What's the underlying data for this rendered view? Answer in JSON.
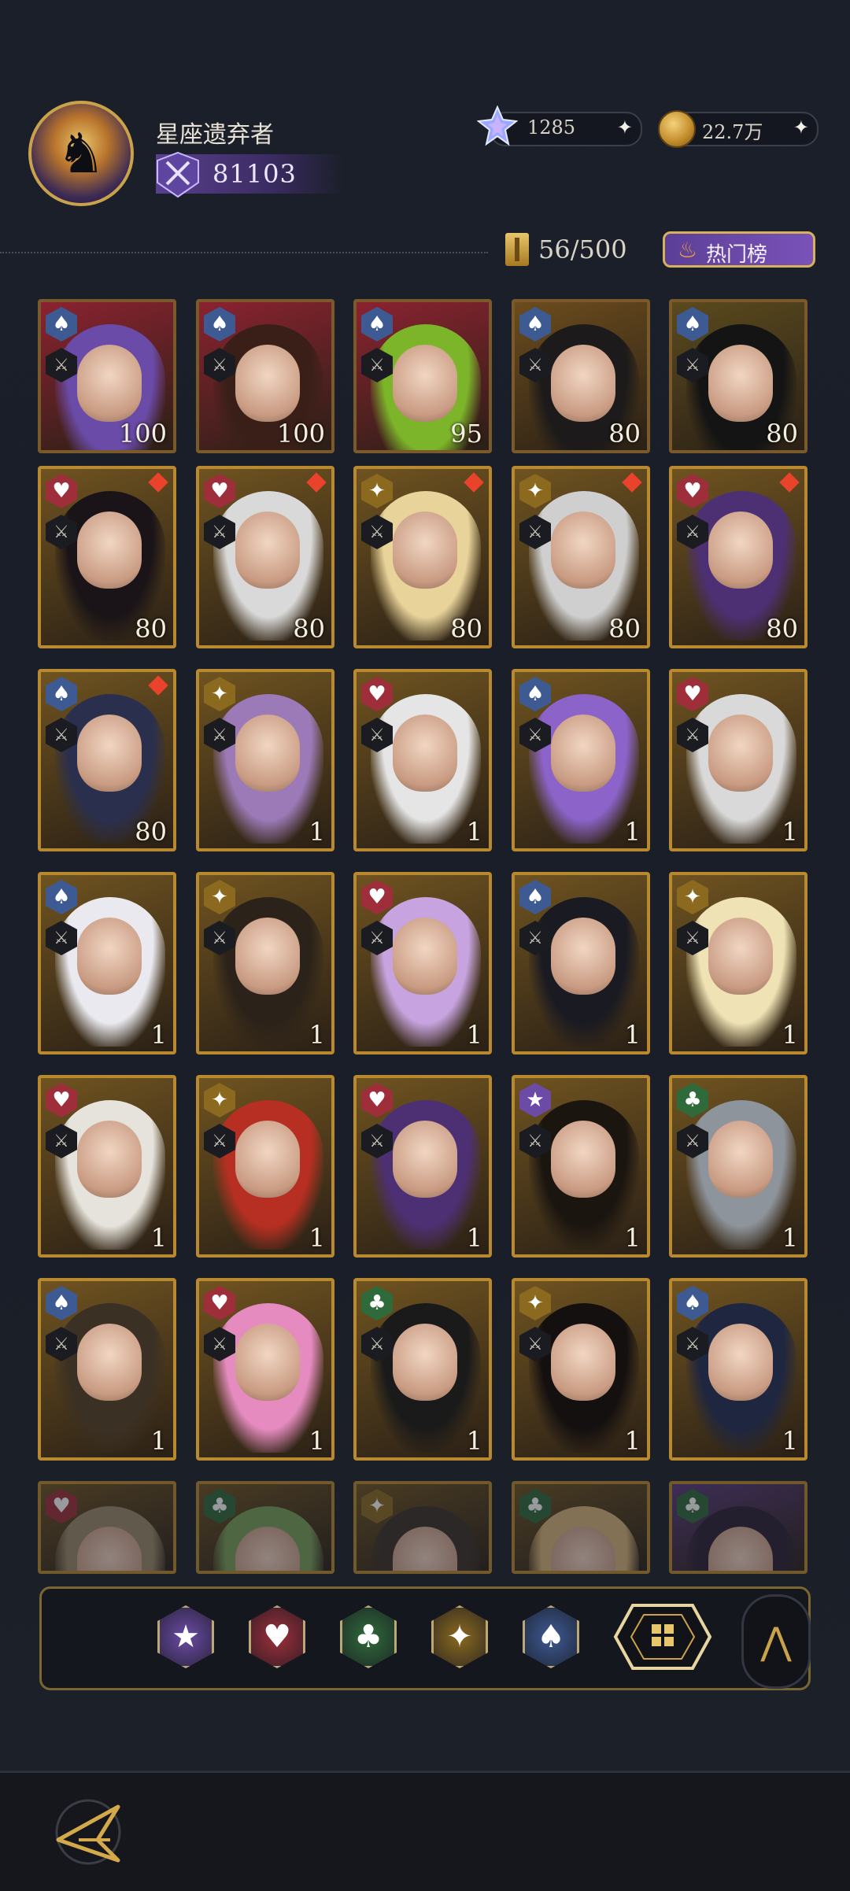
{
  "player": {
    "name": "星座遗弃者",
    "rank_value": "81103"
  },
  "currencies": {
    "gems": "1285",
    "gold": "22.7万"
  },
  "capacity": "56/500",
  "hot_button_label": "热门榜",
  "cards": [
    {
      "suit": "spade",
      "level": "100",
      "star": false,
      "bg": "#8b2230",
      "tone": "#6a4ba8"
    },
    {
      "suit": "spade",
      "level": "100",
      "star": false,
      "bg": "#8b2230",
      "tone": "#3a1f18"
    },
    {
      "suit": "spade",
      "level": "95",
      "star": false,
      "bg": "#8b2230",
      "tone": "#7cb52a"
    },
    {
      "suit": "spade",
      "level": "80",
      "star": false,
      "bg": "#6b4c1d",
      "tone": "#1c1a1a"
    },
    {
      "suit": "spade",
      "level": "80",
      "star": false,
      "bg": "#5b4a1e",
      "tone": "#141414"
    },
    {
      "suit": "heart",
      "level": "80",
      "star": true,
      "bg": "#6f5320",
      "tone": "#1a1418"
    },
    {
      "suit": "heart",
      "level": "80",
      "star": true,
      "bg": "#6f5320",
      "tone": "#d9d9d9"
    },
    {
      "suit": "diamond",
      "level": "80",
      "star": true,
      "bg": "#6f5320",
      "tone": "#e8d39a"
    },
    {
      "suit": "diamond",
      "level": "80",
      "star": true,
      "bg": "#6f5320",
      "tone": "#cfcfcf"
    },
    {
      "suit": "heart",
      "level": "80",
      "star": true,
      "bg": "#6f5320",
      "tone": "#4d2f73"
    },
    {
      "suit": "spade",
      "level": "80",
      "star": true,
      "bg": "#6f5320",
      "tone": "#2a2f4e"
    },
    {
      "suit": "diamond",
      "level": "1",
      "star": false,
      "bg": "#6f5320",
      "tone": "#9c7ab8"
    },
    {
      "suit": "heart",
      "level": "1",
      "star": false,
      "bg": "#6f5320",
      "tone": "#e5e5e5"
    },
    {
      "suit": "spade",
      "level": "1",
      "star": false,
      "bg": "#6f5320",
      "tone": "#8b63c9"
    },
    {
      "suit": "heart",
      "level": "1",
      "star": false,
      "bg": "#6f5320",
      "tone": "#d9d9d9"
    },
    {
      "suit": "spade",
      "level": "1",
      "star": false,
      "bg": "#6f5320",
      "tone": "#e9e9ef"
    },
    {
      "suit": "diamond",
      "level": "1",
      "star": false,
      "bg": "#6f5320",
      "tone": "#2b2219"
    },
    {
      "suit": "heart",
      "level": "1",
      "star": false,
      "bg": "#6f5320",
      "tone": "#c7a4e0"
    },
    {
      "suit": "spade",
      "level": "1",
      "star": false,
      "bg": "#6f5320",
      "tone": "#1a1a22"
    },
    {
      "suit": "diamond",
      "level": "1",
      "star": false,
      "bg": "#6f5320",
      "tone": "#efe3b5"
    },
    {
      "suit": "heart",
      "level": "1",
      "star": false,
      "bg": "#6f5320",
      "tone": "#e6e3dc"
    },
    {
      "suit": "diamond",
      "level": "1",
      "star": false,
      "bg": "#6f5320",
      "tone": "#b72f22"
    },
    {
      "suit": "heart",
      "level": "1",
      "star": false,
      "bg": "#6f5320",
      "tone": "#4d2f73"
    },
    {
      "suit": "star",
      "level": "1",
      "star": false,
      "bg": "#6f5320",
      "tone": "#1b1510"
    },
    {
      "suit": "club",
      "level": "1",
      "star": false,
      "bg": "#6f5320",
      "tone": "#8e949c"
    },
    {
      "suit": "spade",
      "level": "1",
      "star": false,
      "bg": "#6f5320",
      "tone": "#3b3024"
    },
    {
      "suit": "heart",
      "level": "1",
      "star": false,
      "bg": "#6f5320",
      "tone": "#e58bc0"
    },
    {
      "suit": "club",
      "level": "1",
      "star": false,
      "bg": "#6f5320",
      "tone": "#1a1a1a"
    },
    {
      "suit": "diamond",
      "level": "1",
      "star": false,
      "bg": "#6f5320",
      "tone": "#141010"
    },
    {
      "suit": "spade",
      "level": "1",
      "star": false,
      "bg": "#6f5320",
      "tone": "#1e2640"
    },
    {
      "suit": "heart",
      "level": "",
      "star": false,
      "bg": "#6f5320",
      "tone": "#9a8a6a",
      "partial": true
    },
    {
      "suit": "club",
      "level": "",
      "star": false,
      "bg": "#6f5320",
      "tone": "#7aa05a",
      "partial": true
    },
    {
      "suit": "diamond",
      "level": "",
      "star": false,
      "bg": "#6f5320",
      "tone": "#3a3028",
      "partial": true
    },
    {
      "suit": "club",
      "level": "",
      "star": false,
      "bg": "#6f5320",
      "tone": "#d8b47a",
      "partial": true
    },
    {
      "suit": "club",
      "level": "",
      "star": false,
      "bg": "#5a3a7a",
      "tone": "#2a1f35",
      "partial": true
    }
  ],
  "suit_colors": {
    "spade": "#3d5a93",
    "heart": "#9e2f3a",
    "diamond": "#8b6a1f",
    "club": "#2f6b3a",
    "star": "#6b4ba6"
  },
  "suit_glyphs": {
    "spade": "♠",
    "heart": "♥",
    "diamond": "✦",
    "club": "♣",
    "star": "★"
  },
  "filters": [
    {
      "name": "star-filter",
      "glyph": "★",
      "color": "#6b4ba6"
    },
    {
      "name": "heart-filter",
      "glyph": "♥",
      "color": "#9e2f3a"
    },
    {
      "name": "club-filter",
      "glyph": "♣",
      "color": "#2f6b3a"
    },
    {
      "name": "diamond-filter",
      "glyph": "✦",
      "color": "#8b6a1f"
    },
    {
      "name": "spade-filter",
      "glyph": "♠",
      "color": "#3d5a93"
    }
  ],
  "icons": {
    "avatar": "raven-avatar-icon",
    "rank": "crossed-swords-icon",
    "gem": "crystal-gem-icon",
    "coin": "gold-coin-icon",
    "back": "back-arrow-icon",
    "collapse": "chevron-up-icon"
  }
}
